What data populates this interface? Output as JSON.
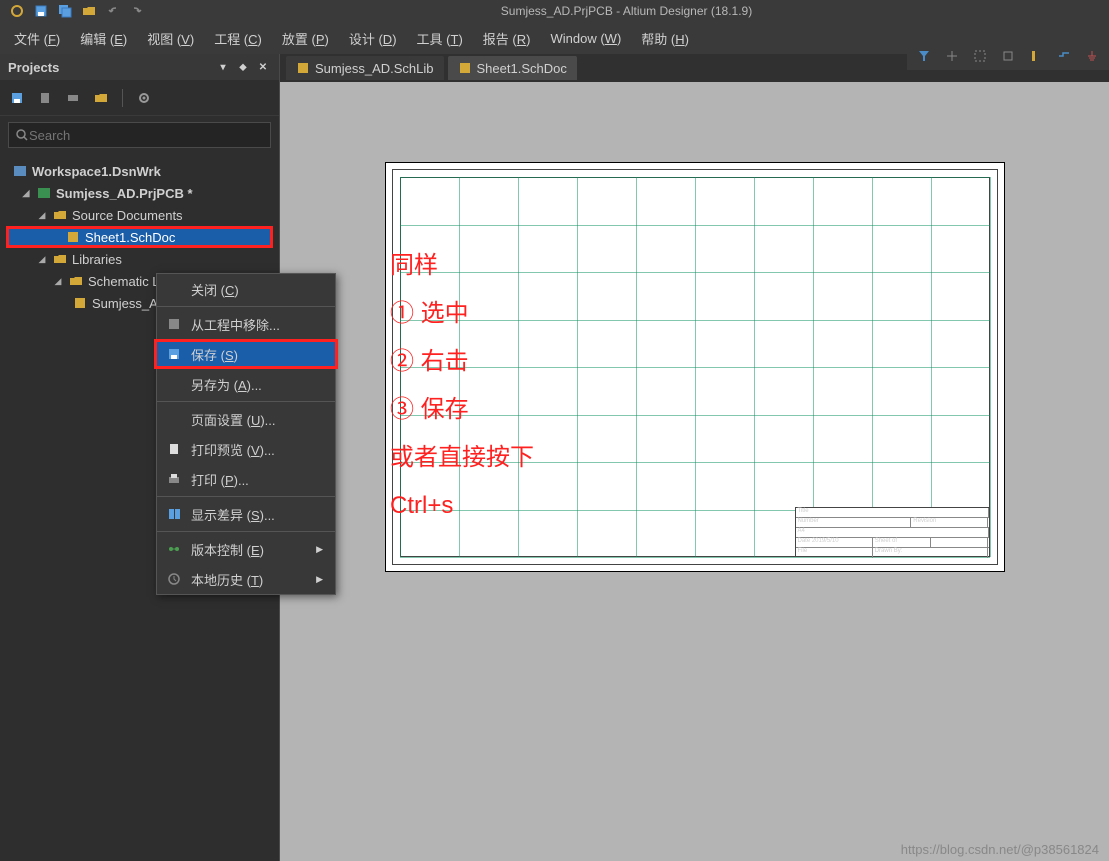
{
  "app": {
    "title": "Sumjess_AD.PrjPCB - Altium Designer (18.1.9)"
  },
  "menubar": [
    {
      "label": "文件 (",
      "hotkey": "F",
      "suffix": ")"
    },
    {
      "label": "编辑 (",
      "hotkey": "E",
      "suffix": ")"
    },
    {
      "label": "视图 (",
      "hotkey": "V",
      "suffix": ")"
    },
    {
      "label": "工程 (",
      "hotkey": "C",
      "suffix": ")"
    },
    {
      "label": "放置 (",
      "hotkey": "P",
      "suffix": ")"
    },
    {
      "label": "设计 (",
      "hotkey": "D",
      "suffix": ")"
    },
    {
      "label": "工具 (",
      "hotkey": "T",
      "suffix": ")"
    },
    {
      "label": "报告 (",
      "hotkey": "R",
      "suffix": ")"
    },
    {
      "label": "Window (",
      "hotkey": "W",
      "suffix": ")"
    },
    {
      "label": "帮助 (",
      "hotkey": "H",
      "suffix": ")"
    }
  ],
  "panel": {
    "title": "Projects",
    "search_placeholder": "Search",
    "tree": {
      "workspace": "Workspace1.DsnWrk",
      "project": "Sumjess_AD.PrjPCB *",
      "source_docs": "Source Documents",
      "sheet": "Sheet1.SchDoc",
      "libraries": "Libraries",
      "schlib_group": "Schematic Li",
      "schlib_item": "Sumjess_A"
    }
  },
  "tabs": [
    {
      "label": "Sumjess_AD.SchLib",
      "active": false
    },
    {
      "label": "Sheet1.SchDoc",
      "active": true
    }
  ],
  "context_menu": {
    "close": "关闭 (C)",
    "remove": "从工程中移除...",
    "save": "保存 (S)",
    "saveas": "另存为 (A)...",
    "pagesetup": "页面设置 (U)...",
    "printpreview": "打印预览 (V)...",
    "print": "打印 (P)...",
    "showdiff": "显示差异 (S)...",
    "version": "版本控制 (E)",
    "history": "本地历史 (T)"
  },
  "annotation": {
    "l1": "同样",
    "l2": "① 选中",
    "l3": "② 右击",
    "l4": "③ 保存",
    "l5": "或者直接按下",
    "l6": "Ctrl+s"
  },
  "watermark": "https://blog.csdn.net/@p38561824",
  "titleblock": {
    "date": "2019/5/10"
  }
}
